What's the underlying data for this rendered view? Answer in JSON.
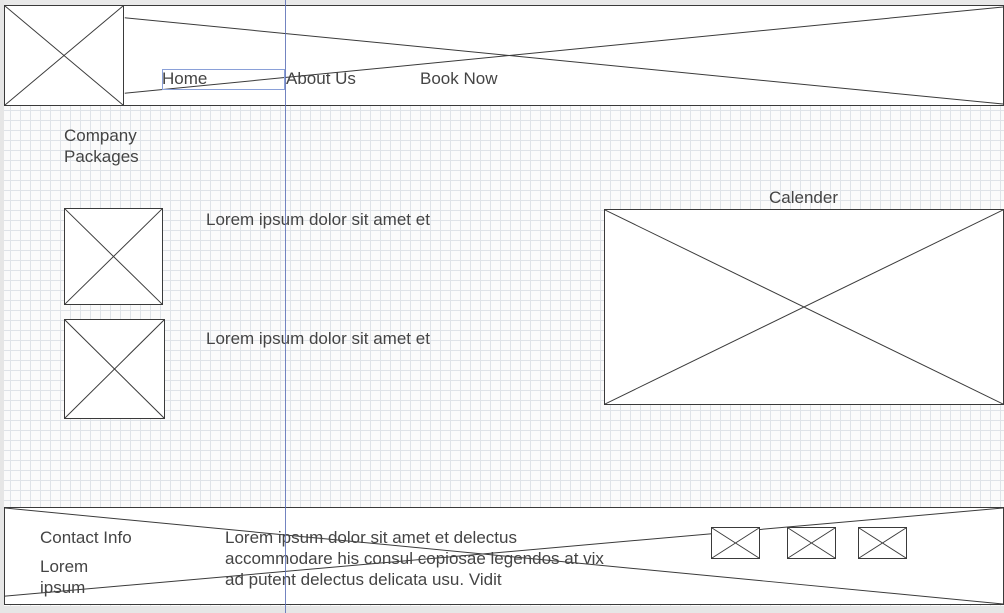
{
  "header": {
    "nav": [
      {
        "label": "Home",
        "icon": "home"
      },
      {
        "label": "About Us",
        "icon": "about"
      },
      {
        "label": "Book Now",
        "icon": "book"
      }
    ]
  },
  "main": {
    "section_title": "Company Packages",
    "packages": [
      {
        "text": "Lorem ipsum dolor sit amet et"
      },
      {
        "text": "Lorem ipsum dolor sit amet et"
      }
    ],
    "calendar_label": "Calender"
  },
  "footer": {
    "contact_title": "Contact Info",
    "contact_sub": "Lorem ipsum",
    "body_text": "Lorem ipsum dolor sit amet et delectus accommodare his consul copiosae legendos at vix ad putent delectus delicata usu. Vidit"
  }
}
